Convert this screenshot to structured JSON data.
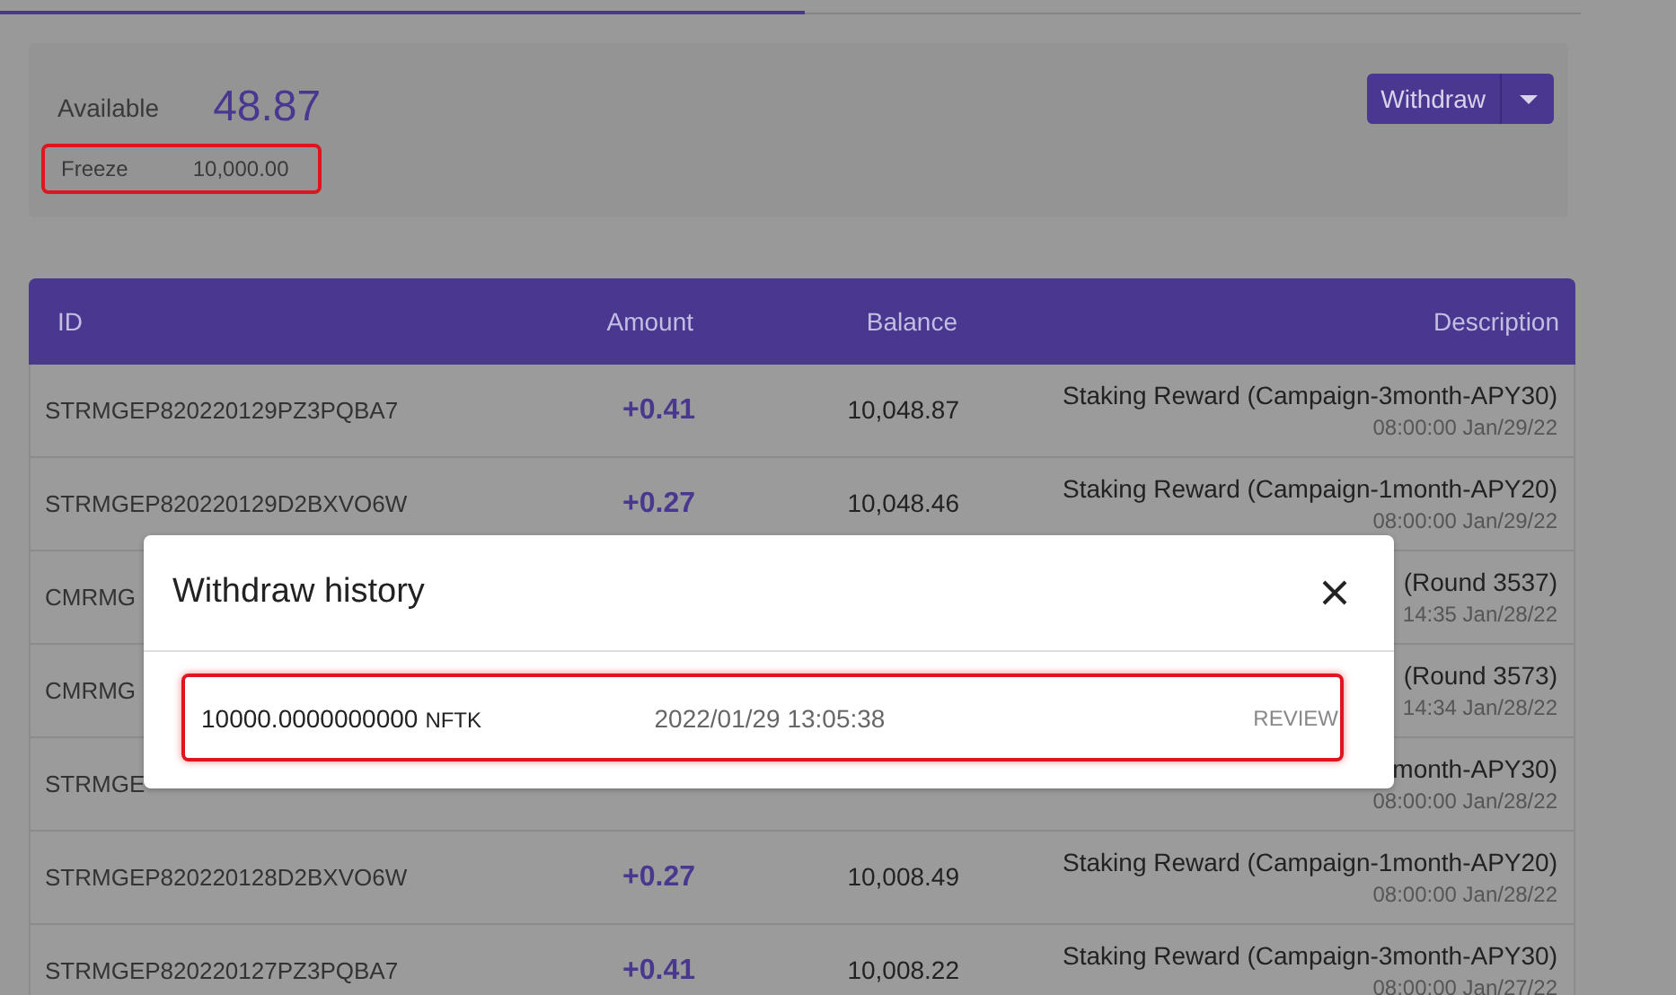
{
  "tab_bar": {
    "tabs": [
      {
        "selected": true
      },
      {
        "selected": false
      }
    ]
  },
  "balance_card": {
    "available_label": "Available",
    "available_value": "48.87",
    "freeze_label": "Freeze",
    "freeze_value": "10,000.00",
    "freeze_highlighted": true,
    "withdraw_button": "Withdraw"
  },
  "table": {
    "columns": [
      "ID",
      "Amount",
      "Balance",
      "Description"
    ],
    "rows": [
      {
        "id": "STRMGEP820220129PZ3PQBA7",
        "amount": "+0.41",
        "balance": "10,048.87",
        "description": "Staking Reward (Campaign-3month-APY30)",
        "time": "08:00:00 Jan/29/22"
      },
      {
        "id": "STRMGEP820220129D2BXVO6W",
        "amount": "+0.27",
        "balance": "10,048.46",
        "description": "Staking Reward (Campaign-1month-APY20)",
        "time": "08:00:00 Jan/29/22"
      },
      {
        "id": "CMRMG",
        "description": "(Round 3537)",
        "time": "14:35 Jan/28/22"
      },
      {
        "id": "CMRMG",
        "description": "(Round 3573)",
        "time": "14:34 Jan/28/22"
      },
      {
        "id": "STRMGE",
        "description": "month-APY30)",
        "time": "08:00:00 Jan/28/22"
      },
      {
        "id": "STRMGEP820220128D2BXVO6W",
        "amount": "+0.27",
        "balance": "10,008.49",
        "description": "Staking Reward (Campaign-1month-APY20)",
        "time": "08:00:00 Jan/28/22"
      },
      {
        "id": "STRMGEP820220127PZ3PQBA7",
        "amount": "+0.41",
        "balance": "10,008.22",
        "description": "Staking Reward (Campaign-3month-APY30)",
        "time": "08:00:00 Jan/27/22"
      }
    ]
  },
  "dialog": {
    "title": "Withdraw history",
    "items": [
      {
        "amount": "10000.0000000000",
        "unit": "NFTK",
        "date": "2022/01/29 13:05:38",
        "status": "REVIEW",
        "highlighted": true
      }
    ]
  }
}
